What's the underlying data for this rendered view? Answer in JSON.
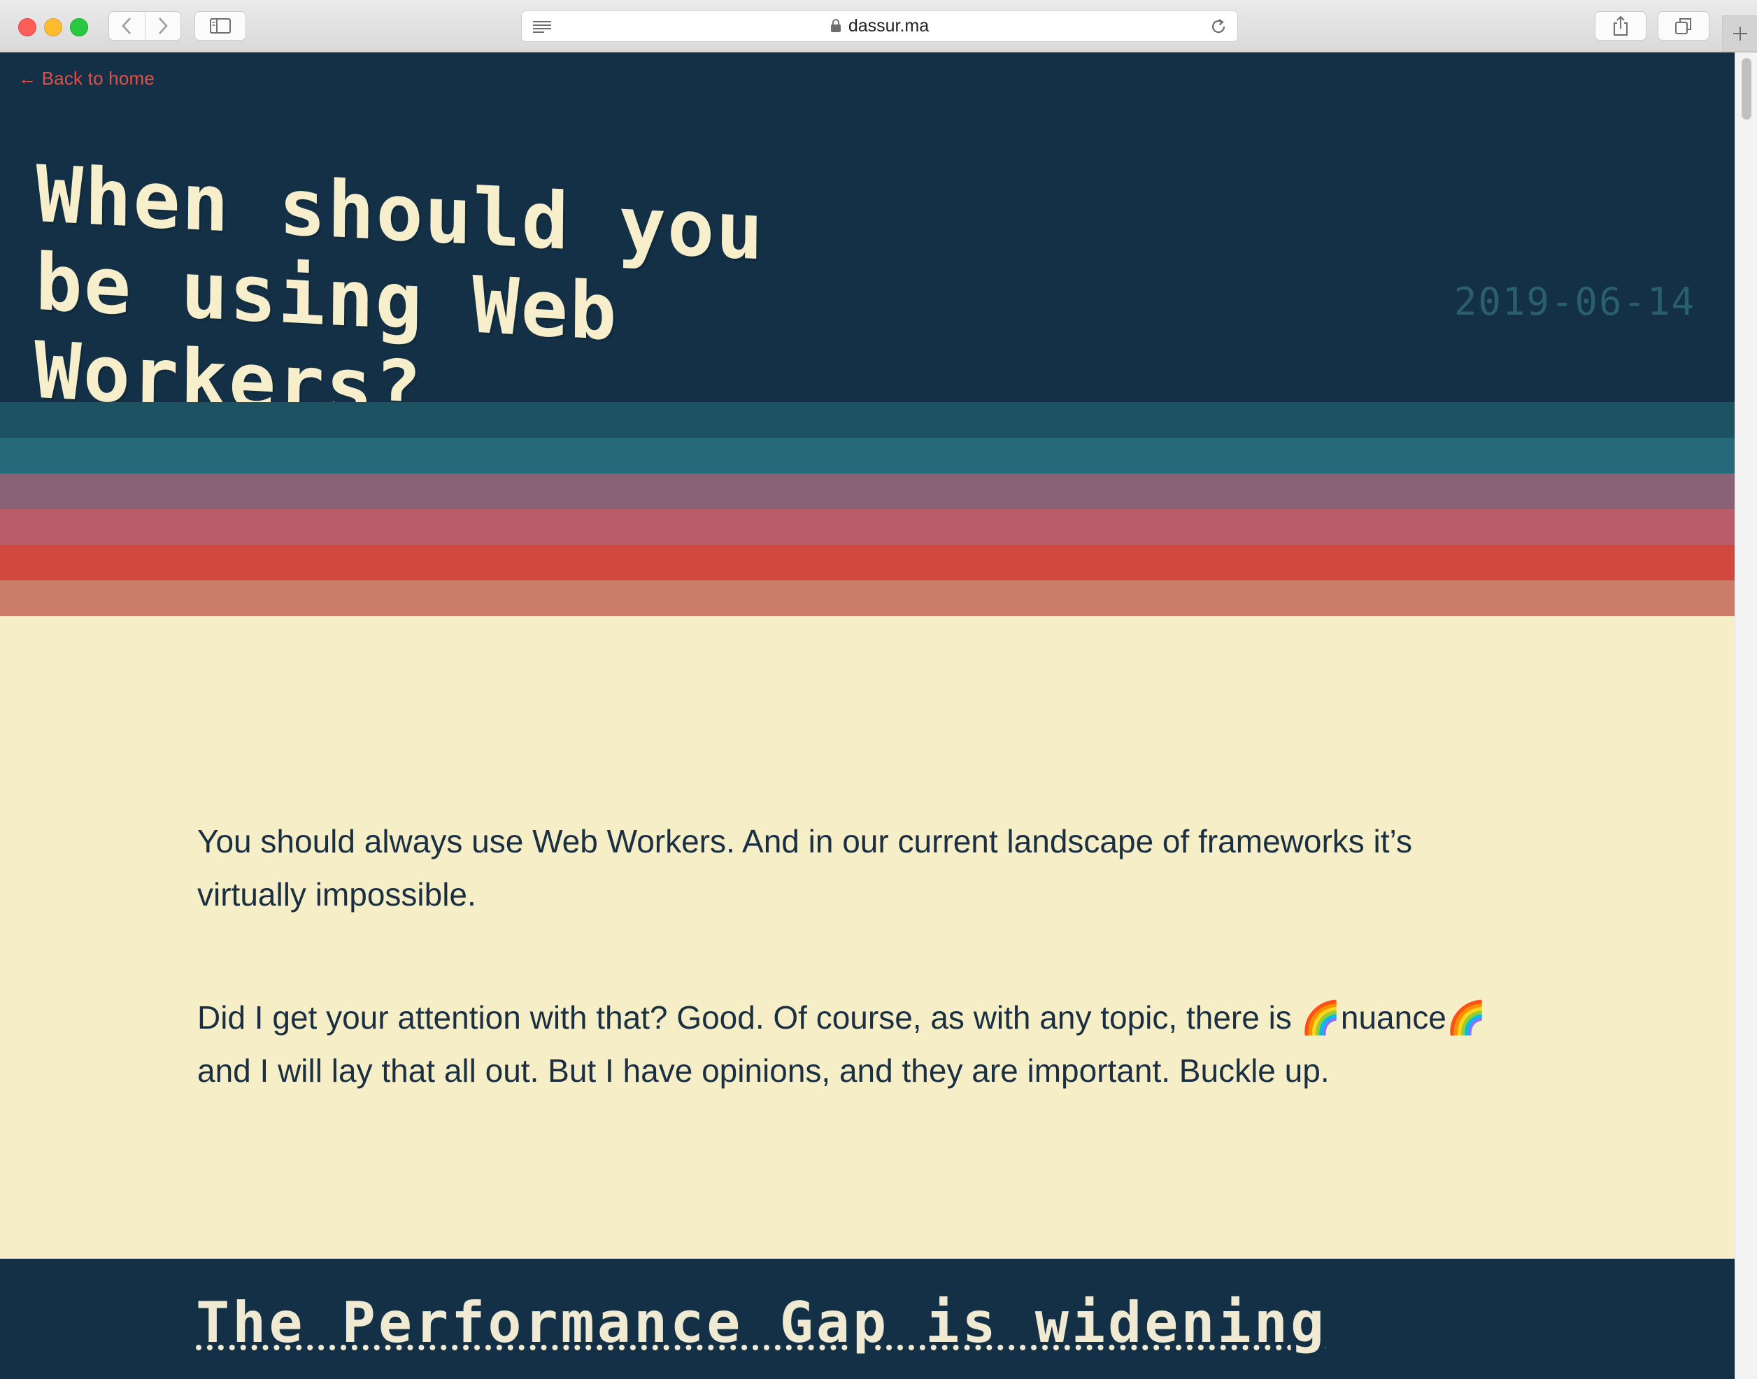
{
  "browser": {
    "url": "dassur.ma",
    "icons": {
      "back": "chevron-left-icon",
      "forward": "chevron-right-icon",
      "sidebar": "sidebar-icon",
      "reader": "reader-mode-icon",
      "lock": "lock-icon",
      "reload": "reload-icon",
      "share": "share-icon",
      "tabs": "tab-overview-icon",
      "new_tab": "plus-icon"
    }
  },
  "page": {
    "back_link": "← Back to home",
    "title": "When should you be using Web Workers?",
    "date": "2019-06-14",
    "paragraphs": [
      "You should always use Web Workers. And in our current landscape of frameworks it’s virtually impossible.",
      "Did I get your attention with that? Good. Of course, as with any topic, there is 🌈nuance🌈 and I will lay that all out. But I have opinions, and they are important. Buckle up."
    ],
    "section_heading": "The Performance Gap is widening"
  },
  "colors": {
    "hero_bg": "#133046",
    "page_bg": "#f6eec6",
    "accent_link": "#d9534a",
    "date": "#2a5f6e",
    "stripes": [
      "#1c5262",
      "#26697b",
      "#8a6276",
      "#b95d6b",
      "#d2473e",
      "#cc7c6a"
    ]
  }
}
